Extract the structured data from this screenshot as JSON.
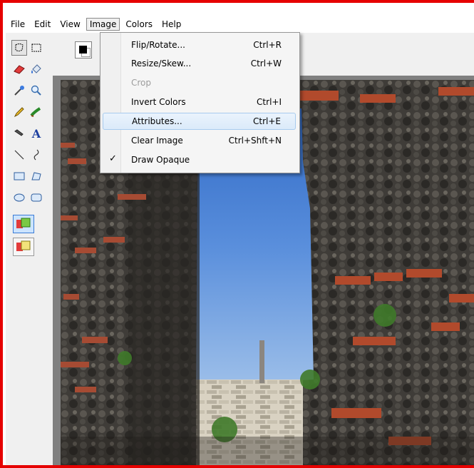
{
  "menubar": {
    "items": [
      {
        "label": "File"
      },
      {
        "label": "Edit"
      },
      {
        "label": "View"
      },
      {
        "label": "Image"
      },
      {
        "label": "Colors"
      },
      {
        "label": "Help"
      }
    ],
    "active": "Image"
  },
  "image_menu": {
    "items": [
      {
        "label": "Flip/Rotate...",
        "shortcut": "Ctrl+R",
        "enabled": true
      },
      {
        "label": "Resize/Skew...",
        "shortcut": "Ctrl+W",
        "enabled": true
      },
      {
        "label": "Crop",
        "shortcut": "",
        "enabled": false
      },
      {
        "label": "Invert Colors",
        "shortcut": "Ctrl+I",
        "enabled": true
      },
      {
        "label": "Attributes...",
        "shortcut": "Ctrl+E",
        "enabled": true,
        "highlighted": true
      },
      {
        "label": "Clear Image",
        "shortcut": "Ctrl+Shft+N",
        "enabled": true
      },
      {
        "label": "Draw Opaque",
        "shortcut": "",
        "enabled": true,
        "checked": true,
        "check_glyph": "✓"
      }
    ]
  },
  "toolbox": {
    "tools": [
      "free-form-select-icon",
      "select-icon",
      "eraser-icon",
      "fill-icon",
      "pick-color-icon",
      "magnifier-icon",
      "pencil-icon",
      "brush-icon",
      "airbrush-icon",
      "text-icon",
      "line-icon",
      "curve-icon",
      "rectangle-icon",
      "polygon-icon",
      "ellipse-icon",
      "rounded-rectangle-icon"
    ],
    "selected_tool": "free-form-select-icon",
    "text_tool_glyph": "A",
    "options": [
      "opaque-selection-icon",
      "transparent-selection-icon"
    ]
  },
  "colors": {
    "window_border": "#e60000",
    "sky": "#4f86d6",
    "menu_highlight": "#dbeafa"
  }
}
